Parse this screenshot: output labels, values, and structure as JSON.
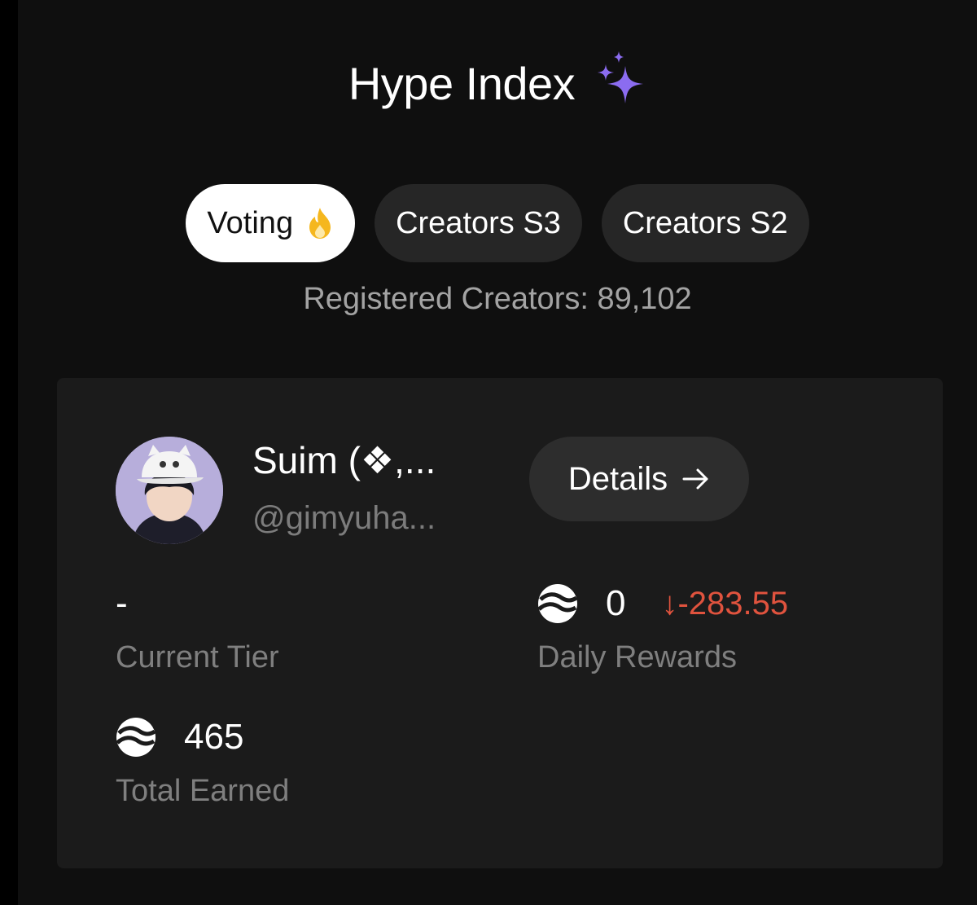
{
  "header": {
    "title": "Hype Index",
    "title_icon": "sparkles-icon"
  },
  "tabs": [
    {
      "label": "Voting",
      "icon": "fire-icon",
      "active": true
    },
    {
      "label": "Creators S3",
      "active": false
    },
    {
      "label": "Creators S2",
      "active": false
    }
  ],
  "registered_text": "Registered Creators: 89,102",
  "profile": {
    "name": "Suim (❖,...",
    "handle": "@gimyuha...",
    "details_label": "Details",
    "details_icon": "arrow-right-icon"
  },
  "stats": {
    "current_tier": {
      "value": "-",
      "label": "Current Tier"
    },
    "daily_rewards": {
      "value": "0",
      "delta": "↓-283.55",
      "label": "Daily Rewards",
      "icon": "token-icon"
    },
    "total_earned": {
      "value": "465",
      "label": "Total Earned",
      "icon": "token-icon"
    }
  },
  "colors": {
    "background": "#0f0f0f",
    "card": "#1b1b1b",
    "pill": "#262626",
    "accent_sparkle": "#8b6cf0",
    "negative": "#e0533e"
  }
}
